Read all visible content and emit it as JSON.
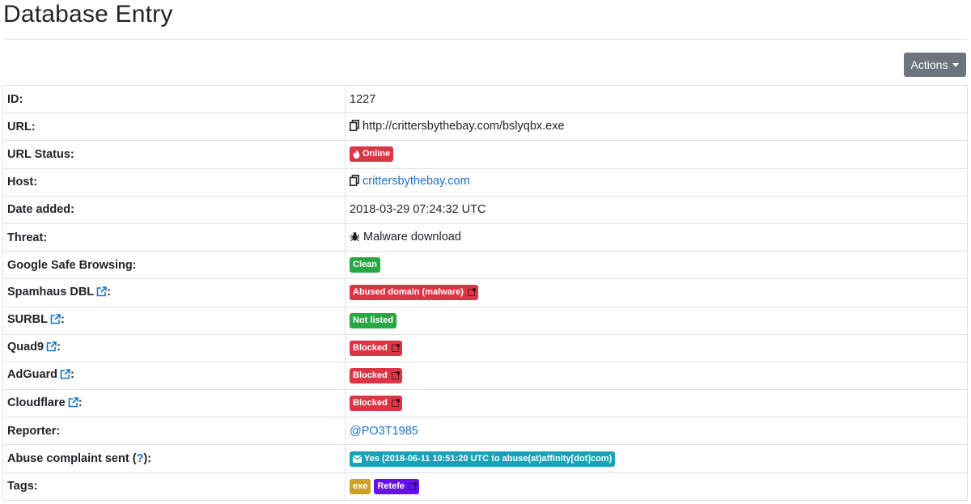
{
  "page": {
    "title": "Database Entry",
    "actions_label": "Actions"
  },
  "colors": {
    "danger": "#dc3545",
    "success": "#28a745",
    "info": "#17a2b8",
    "warning": "#c9a227",
    "purple": "#6610f2",
    "link": "#1a73c9",
    "secondary": "#6c757d"
  },
  "rows": {
    "id": {
      "label": "ID:",
      "value": "1227"
    },
    "url": {
      "label": "URL:",
      "value": "http://crittersbythebay.com/bslyqbx.exe",
      "icon": "copy-icon"
    },
    "url_status": {
      "label": "URL Status:",
      "badge": "Online",
      "icon": "fire-icon"
    },
    "host": {
      "label": "Host:",
      "value": "crittersbythebay.com",
      "icon": "copy-icon"
    },
    "date_added": {
      "label": "Date added:",
      "value": "2018-03-29 07:24:32 UTC"
    },
    "threat": {
      "label": "Threat:",
      "value": "Malware download",
      "icon": "bug-icon"
    },
    "gsb": {
      "label": "Google Safe Browsing:",
      "badge": "Clean"
    },
    "spamhaus": {
      "label": "Spamhaus DBL",
      "suffix": ":",
      "badge": "Abused domain (malware)"
    },
    "surbl": {
      "label": "SURBL",
      "suffix": ":",
      "badge": "Not listed"
    },
    "quad9": {
      "label": "Quad9",
      "suffix": ":",
      "badge": "Blocked"
    },
    "adguard": {
      "label": "AdGuard",
      "suffix": ":",
      "badge": "Blocked"
    },
    "cloudflare": {
      "label": "Cloudflare",
      "suffix": ":",
      "badge": "Blocked"
    },
    "reporter": {
      "label": "Reporter:",
      "value": "@PO3T1985"
    },
    "abuse": {
      "label_pre": "Abuse complaint sent (",
      "help": "?",
      "label_post": "):",
      "badge": "Yes (2018-06-11 10:51:20 UTC to abuse(at)affinity[dot]com)",
      "icon": "envelope-icon"
    },
    "tags": {
      "label": "Tags:",
      "items": [
        "exe",
        "Retefe"
      ]
    }
  }
}
